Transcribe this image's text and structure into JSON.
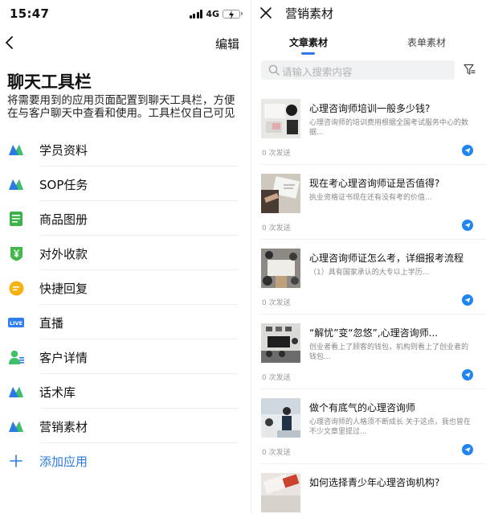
{
  "status_bar": {
    "time": "15:47",
    "network": "4G"
  },
  "left_pane": {
    "edit_label": "编辑",
    "title": "聊天工具栏",
    "description": "将需要用到的应用页面配置到聊天工具栏，方便在与客户聊天中查看和使用。工具栏仅自己可见",
    "tools": [
      {
        "label": "学员资料",
        "icon": "brand-m-icon"
      },
      {
        "label": "SOP任务",
        "icon": "brand-m-icon"
      },
      {
        "label": "商品图册",
        "icon": "catalog-icon"
      },
      {
        "label": "对外收款",
        "icon": "yuan-shield-icon"
      },
      {
        "label": "快捷回复",
        "icon": "quick-reply-icon"
      },
      {
        "label": "直播",
        "icon": "live-icon",
        "badge": "LIVE"
      },
      {
        "label": "客户详情",
        "icon": "customer-icon"
      },
      {
        "label": "话术库",
        "icon": "brand-m-icon"
      },
      {
        "label": "营销素材",
        "icon": "brand-m-icon"
      }
    ],
    "add_label": "添加应用",
    "colors": {
      "brand_blue": "#2a7be4",
      "brand_green": "#3fbf6a",
      "catalog_green": "#3cb34a",
      "pay_green": "#41b84a",
      "reply_yellow": "#f5b30f",
      "live_blue": "#2f7ef0"
    }
  },
  "right_pane": {
    "title": "营销素材",
    "tabs": [
      {
        "label": "文章素材",
        "active": true
      },
      {
        "label": "表单素材",
        "active": false
      }
    ],
    "search_placeholder": "请输入搜索内容",
    "articles": [
      {
        "title": "心理咨询师培训一般多少钱?",
        "summary": "心理咨询师的培训费用根据全国考试服务中心的数据...",
        "send_count": "0 次发送"
      },
      {
        "title": "现在考心理咨询师证是否值得?",
        "summary": "执业资格证书现在还有没有考的价值...",
        "send_count": "0 次发送"
      },
      {
        "title": "心理咨询师证怎么考，详细报考流程",
        "summary": "（1）具有国家承认的大专以上学历...",
        "send_count": "0 次发送"
      },
      {
        "title": "“解忧”变“忽悠”,心理咨询师...",
        "summary": "创业者看上了顾客的钱包，机构则看上了创业者的钱包...",
        "send_count": "0 次发送"
      },
      {
        "title": "做个有底气的心理咨询师",
        "summary": "心理咨询师的人格须不断成长 关于这点，我也曾在不少文章里提过...",
        "send_count": "0 次发送"
      },
      {
        "title": "如何选择青少年心理咨询机构?",
        "summary": "",
        "send_count": ""
      }
    ],
    "colors": {
      "accent": "#2a7be4",
      "send_button": "#1f86f0"
    }
  }
}
